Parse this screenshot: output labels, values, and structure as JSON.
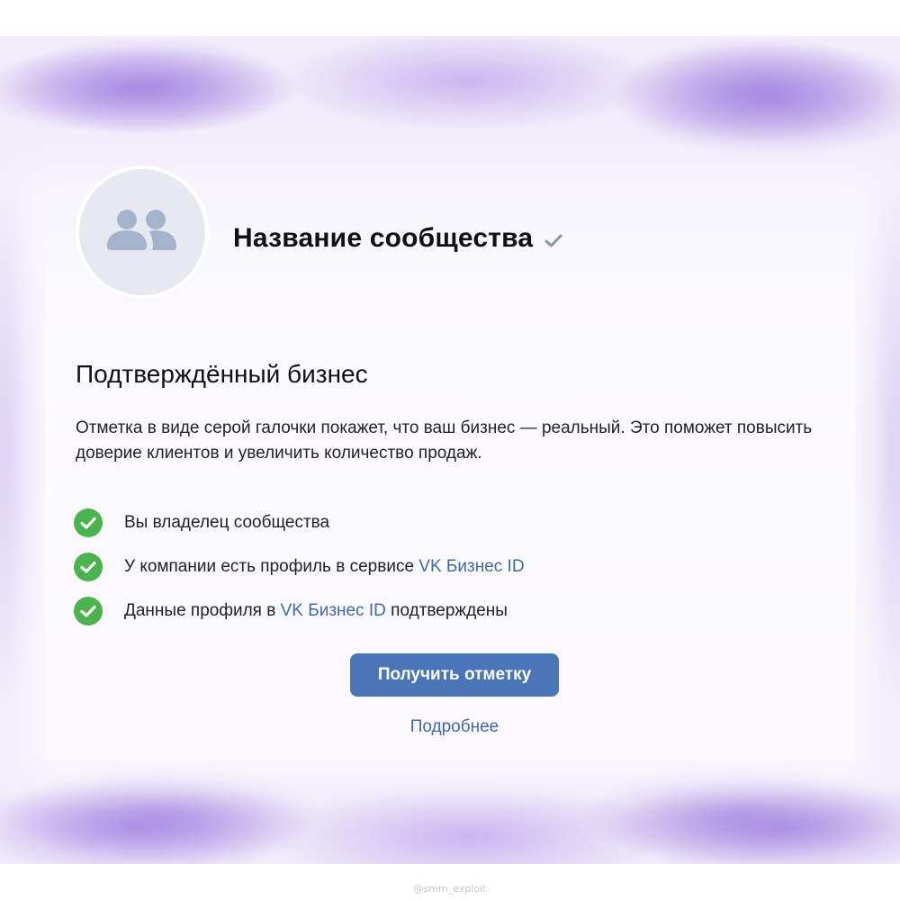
{
  "community": {
    "name": "Название сообщества",
    "avatar_icon": "community-group-icon",
    "verified_icon": "verified-check-icon"
  },
  "section": {
    "heading": "Подтверждённый бизнес",
    "description": "Отметка в виде серой галочки покажет, что ваш бизнес — реальный. Это поможет повысить доверие клиентов и увеличить количество продаж."
  },
  "requirements": [
    {
      "text": "Вы владелец сообщества",
      "link": "",
      "suffix": "",
      "status": "done"
    },
    {
      "text": "У компании есть профиль в сервисе ",
      "link": "VK Бизнес ID",
      "suffix": "",
      "status": "done"
    },
    {
      "text": "Данные профиля в ",
      "link": "VK Бизнес ID",
      "suffix": " подтверждены",
      "status": "done"
    }
  ],
  "actions": {
    "primary_label": "Получить отметку",
    "more_label": "Подробнее"
  },
  "watermark": "@smm_exploit",
  "colors": {
    "accent": "#4a76b7",
    "link": "#3f6aa3",
    "success": "#4bb34b",
    "frame": "#b9a2e8"
  }
}
